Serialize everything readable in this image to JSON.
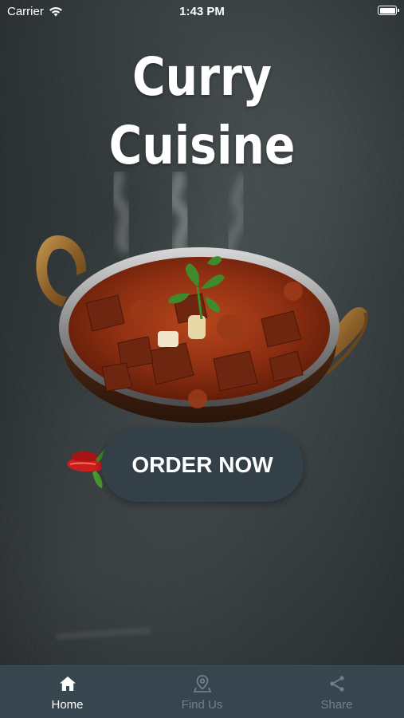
{
  "status_bar": {
    "carrier": "Carrier",
    "time": "1:43 PM",
    "icons": [
      "wifi-icon",
      "battery-icon"
    ]
  },
  "app": {
    "title_line1": "Curry",
    "title_line2": "Cuisine",
    "order_button_label": "ORDER NOW"
  },
  "tab_bar": {
    "items": [
      {
        "label": "Home",
        "icon": "home-icon",
        "active": true
      },
      {
        "label": "Find Us",
        "icon": "location-pin-icon",
        "active": false
      },
      {
        "label": "Share",
        "icon": "share-icon",
        "active": false
      }
    ]
  },
  "colors": {
    "background": "#2f3638",
    "button": "#334047",
    "tab_bar": "#37464e",
    "tab_active": "#ffffff",
    "tab_inactive": "#6e8089"
  }
}
